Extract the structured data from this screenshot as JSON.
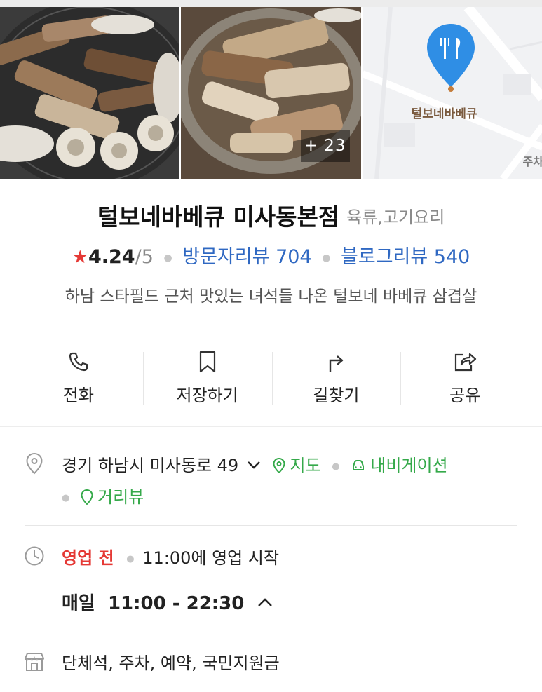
{
  "photos": {
    "more_count": "+ 23",
    "map_pin_label": "털보네바베큐",
    "map_corner_label": "주차"
  },
  "place": {
    "name": "털보네바베큐 미사동본점",
    "category": "육류,고기요리",
    "rating": "4.24",
    "rating_max": "/5",
    "visitor_reviews": "방문자리뷰 704",
    "blog_reviews": "블로그리뷰 540",
    "description": "하남 스타필드 근처 맛있는 녀석들 나온 털보네 바베큐 삼겹살"
  },
  "actions": [
    {
      "label": "전화",
      "icon": "phone-icon"
    },
    {
      "label": "저장하기",
      "icon": "bookmark-icon"
    },
    {
      "label": "길찾기",
      "icon": "directions-icon"
    },
    {
      "label": "공유",
      "icon": "share-icon"
    }
  ],
  "address": {
    "text": "경기 하남시 미사동로 49",
    "map_link": "지도",
    "navigation_link": "내비게이션",
    "street_view_link": "거리뷰"
  },
  "hours": {
    "status": "영업 전",
    "status_detail": "11:00에 영업 시작",
    "range": "매일  11:00 - 22:30"
  },
  "facilities": {
    "text": "단체석, 주차, 예약, 국민지원금"
  },
  "colors": {
    "star": "#e53935",
    "review_link": "#2f68c2",
    "map_link": "#35a94a",
    "status_closed": "#e53935",
    "map_pin": "#2f8ee5"
  }
}
